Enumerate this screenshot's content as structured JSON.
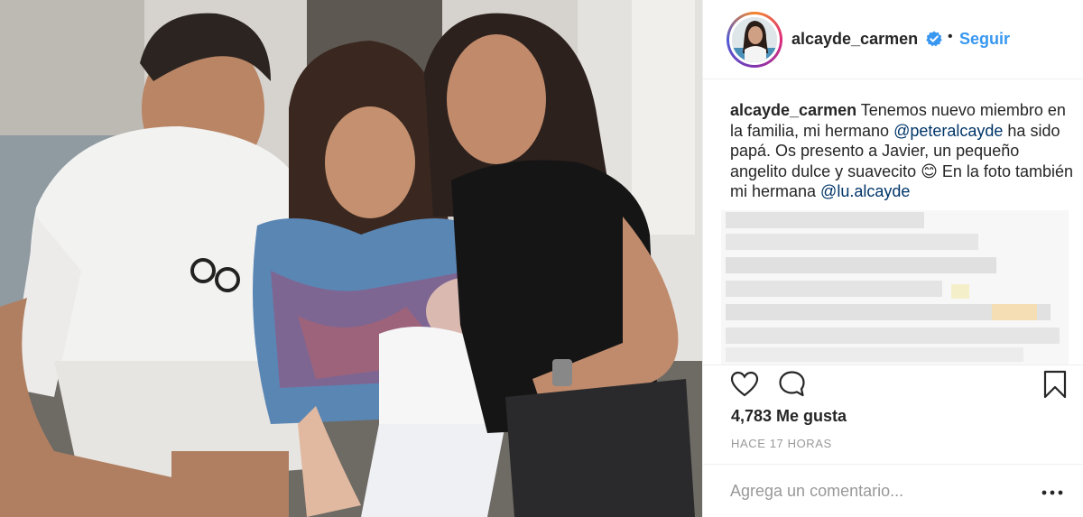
{
  "post": {
    "photo_alt_icon": "family-photo",
    "header": {
      "username": "alcayde_carmen",
      "separator": "•",
      "follow_label": "Seguir"
    },
    "caption": {
      "username": "alcayde_carmen",
      "text_1": " Tenemos nuevo miembro en la familia, mi hermano ",
      "mention_1": "@peteralcayde",
      "text_2": " ha sido papá. Os presento a Javier, un pequeño angelito dulce y suavecito ",
      "emoji": "😊",
      "text_3": " En la foto también mi hermana ",
      "mention_2": "@lu.alcayde"
    },
    "likes": "4,783 Me gusta",
    "timestamp": "HACE 17 HORAS",
    "comment_placeholder": "Agrega un comentario...",
    "colors": {
      "accent": "#3897f0",
      "mention": "#003569",
      "muted": "#999999"
    },
    "icons": [
      "heart-icon",
      "comment-icon",
      "bookmark-icon",
      "more-icon",
      "verified-icon"
    ]
  }
}
